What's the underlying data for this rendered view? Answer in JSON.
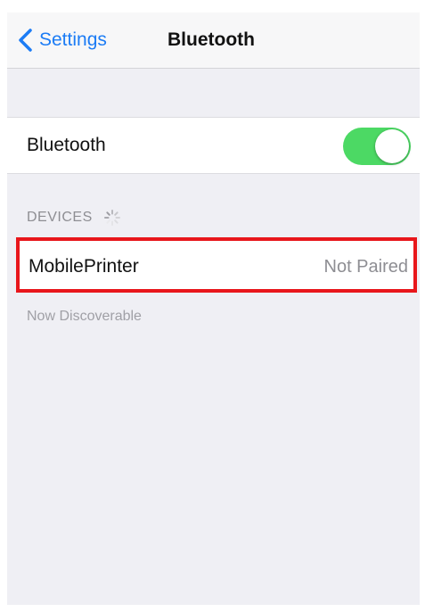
{
  "navbar": {
    "back_label": "Settings",
    "title": "Bluetooth",
    "back_icon": "chevron-left-icon"
  },
  "bluetooth_toggle": {
    "label": "Bluetooth",
    "on": true,
    "on_color": "#4cd964"
  },
  "devices_section": {
    "header": "DEVICES",
    "activity_icon": "spinner-icon",
    "items": [
      {
        "name": "MobilePrinter",
        "status": "Not Paired"
      }
    ]
  },
  "discoverable_text": "Now Discoverable",
  "colors": {
    "accent": "#1c7cf5",
    "highlight_border": "#e8161b",
    "background": "#efeff4"
  }
}
